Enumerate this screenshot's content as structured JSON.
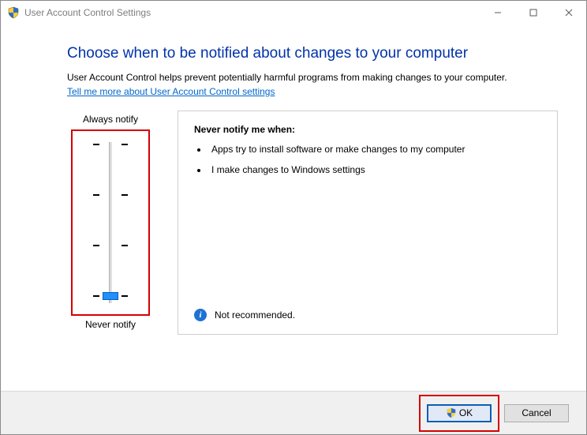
{
  "window": {
    "title": "User Account Control Settings"
  },
  "heading": "Choose when to be notified about changes to your computer",
  "description": "User Account Control helps prevent potentially harmful programs from making changes to your computer.",
  "link_text": "Tell me more about User Account Control settings",
  "slider": {
    "top_label": "Always notify",
    "bottom_label": "Never notify",
    "level_count": 4,
    "current_level": 0
  },
  "panel": {
    "title": "Never notify me when:",
    "bullets": [
      "Apps try to install software or make changes to my computer",
      "I make changes to Windows settings"
    ],
    "recommendation": "Not recommended."
  },
  "buttons": {
    "ok": "OK",
    "cancel": "Cancel"
  },
  "icons": {
    "shield": "shield-icon",
    "info": "info-icon",
    "minimize": "minimize-icon",
    "maximize": "maximize-icon",
    "close": "close-icon"
  }
}
